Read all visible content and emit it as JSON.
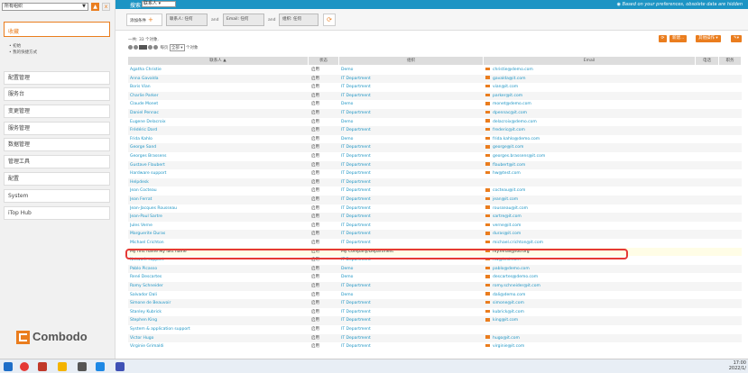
{
  "sidebar": {
    "org_select": "所有组织",
    "favorites_label": "收藏",
    "favorite_links": [
      "初始",
      "我的快捷方式"
    ],
    "menus": [
      "配置管理",
      "服务台",
      "变更管理",
      "服务管理",
      "数据管理",
      "管理工具",
      "配置",
      "System",
      "iTop Hub"
    ],
    "logo_text": "Combodo"
  },
  "topbar": {
    "search_label": "搜索",
    "search_class": "联系人",
    "notice": "Based on your preferences, obsolete data are hidden"
  },
  "filters": {
    "add_criteria": "添加条件",
    "chips": [
      "联系人: 任何",
      "Email: 任何",
      "组织: 任何"
    ],
    "and_label": "and"
  },
  "results": {
    "count_text": "一共: 33 个对象.",
    "per_page_prefix": "每页",
    "per_page_value": "全部",
    "per_page_suffix": "个对象"
  },
  "actions": {
    "new": "新建...",
    "other": "其他操作",
    "more": "工具"
  },
  "table": {
    "headers": [
      "联系人",
      "状态",
      "组织",
      "Email",
      "电话",
      "职务"
    ],
    "rows": [
      [
        "Agatha Christie",
        "启用",
        "Demo",
        "christie@demo.com"
      ],
      [
        "Anna Gavalda",
        "启用",
        "IT Department",
        "gavalda@it.com"
      ],
      [
        "Boris Vian",
        "启用",
        "IT Department",
        "vian@it.com"
      ],
      [
        "Charlie Parker",
        "启用",
        "IT Department",
        "parker@it.com"
      ],
      [
        "Claude Monet",
        "启用",
        "Demo",
        "monet@demo.com"
      ],
      [
        "Daniel Pennac",
        "启用",
        "IT Department",
        "dpennac@it.com"
      ],
      [
        "Eugene Delacroix",
        "启用",
        "Demo",
        "delacroix@demo.com"
      ],
      [
        "Frédéric Dard",
        "启用",
        "IT Department",
        "frederic@it.com"
      ],
      [
        "Frida Kahlo",
        "启用",
        "Demo",
        "frida.kahlo@demo.com"
      ],
      [
        "George Sand",
        "启用",
        "IT Department",
        "george@it.com"
      ],
      [
        "Georges Brassens",
        "启用",
        "IT Department",
        "georges.brassens@it.com"
      ],
      [
        "Gustave Flaubert",
        "启用",
        "IT Department",
        "flaubert@it.com"
      ],
      [
        "Hardware support",
        "启用",
        "IT Department",
        "hw@test.com"
      ],
      [
        "Helpdesk",
        "启用",
        "IT Department",
        ""
      ],
      [
        "Jean Cocteau",
        "启用",
        "IT Department",
        "cocteau@it.com"
      ],
      [
        "Jean Ferrat",
        "启用",
        "IT Department",
        "jean@it.com"
      ],
      [
        "Jean-Jacques Rousseau",
        "启用",
        "IT Department",
        "rousseau@it.com"
      ],
      [
        "Jean-Paul Sartre",
        "启用",
        "IT Department",
        "sartre@it.com"
      ],
      [
        "Jules Verne",
        "启用",
        "IT Department",
        "verne@it.com"
      ],
      [
        "Marguerite Duras",
        "启用",
        "IT Department",
        "duras@it.com"
      ],
      [
        "Michael Crichton",
        "启用",
        "IT Department",
        "michael.crichton@it.com"
      ],
      [
        "My first name My last name",
        "启用",
        "My Company/Department",
        "my.email@foo.org"
      ],
      [
        "Network support",
        "启用",
        "IT Department",
        "nw@test.com"
      ],
      [
        "Pablo Picasso",
        "启用",
        "Demo",
        "pablo@demo.com"
      ],
      [
        "René Descartes",
        "启用",
        "Demo",
        "descartes@demo.com"
      ],
      [
        "Romy Schneider",
        "启用",
        "IT Department",
        "romy.schneider@it.com"
      ],
      [
        "Salvador Dali",
        "启用",
        "Demo",
        "dali@demo.com"
      ],
      [
        "Simone de Beauvoir",
        "启用",
        "IT Department",
        "simone@it.com"
      ],
      [
        "Stanley Kubrick",
        "启用",
        "IT Department",
        "kubrick@it.com"
      ],
      [
        "Stephen King",
        "启用",
        "IT Department",
        "king@it.com"
      ],
      [
        "System & application support",
        "启用",
        "IT Department",
        ""
      ],
      [
        "Victor Hugo",
        "启用",
        "IT Department",
        "hugo@it.com"
      ],
      [
        "Virginie Grimaldi",
        "启用",
        "IT Department",
        "virginie@it.com"
      ]
    ],
    "highlighted_row": 21
  },
  "taskbar": {
    "time": "17:00",
    "date": "2022/1/"
  },
  "colors": {
    "accent": "#ea7d1e",
    "topbar": "#1c94c4",
    "highlight_border": "#e53935"
  }
}
